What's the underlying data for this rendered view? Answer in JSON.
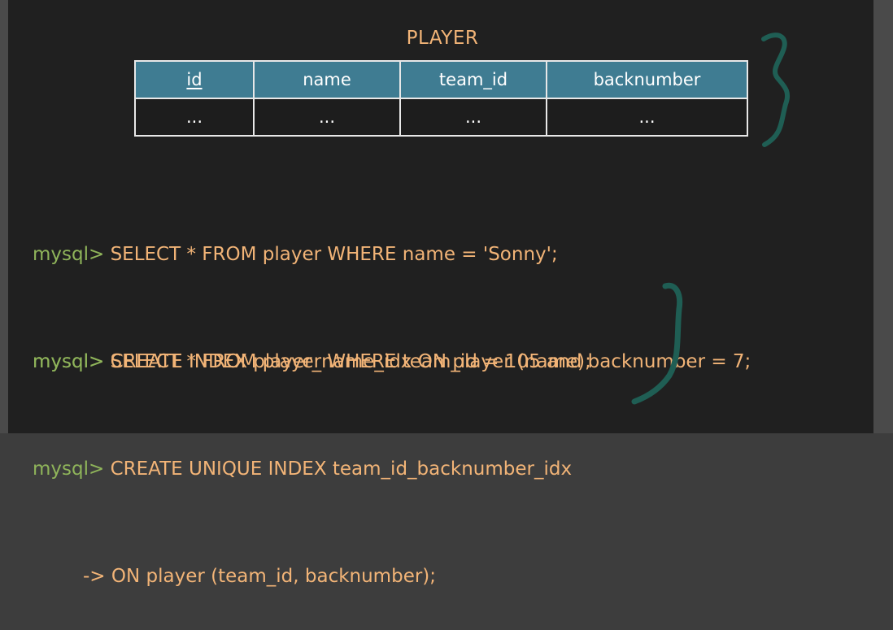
{
  "table": {
    "title": "PLAYER",
    "columns": [
      {
        "label": "id",
        "primary_key": true
      },
      {
        "label": "name"
      },
      {
        "label": "team_id"
      },
      {
        "label": "backnumber"
      }
    ],
    "rows": [
      [
        "...",
        "...",
        "...",
        "..."
      ]
    ]
  },
  "queries": [
    {
      "prompt": "mysql>",
      "sql": " SELECT * FROM player WHERE name = 'Sonny';"
    },
    {
      "prompt": "mysql>",
      "sql": " SELECT * FROM player WHERE team_id = 105 and backnumber = 7;"
    }
  ],
  "index_statements": [
    {
      "prompt": "mysql>",
      "sql": " CREATE INDEX player_name_idx ON player (name);"
    },
    {
      "prompt": "mysql>",
      "sql": " CREATE UNIQUE INDEX team_id_backnumber_idx"
    },
    {
      "prompt": "->",
      "sql": " ON player (team_id, backnumber);"
    }
  ],
  "colors": {
    "background": "#202020",
    "header_fill": "#3f7c92",
    "prompt": "#8fb45a",
    "code": "#f2b477",
    "annotation": "#1f5e54"
  }
}
